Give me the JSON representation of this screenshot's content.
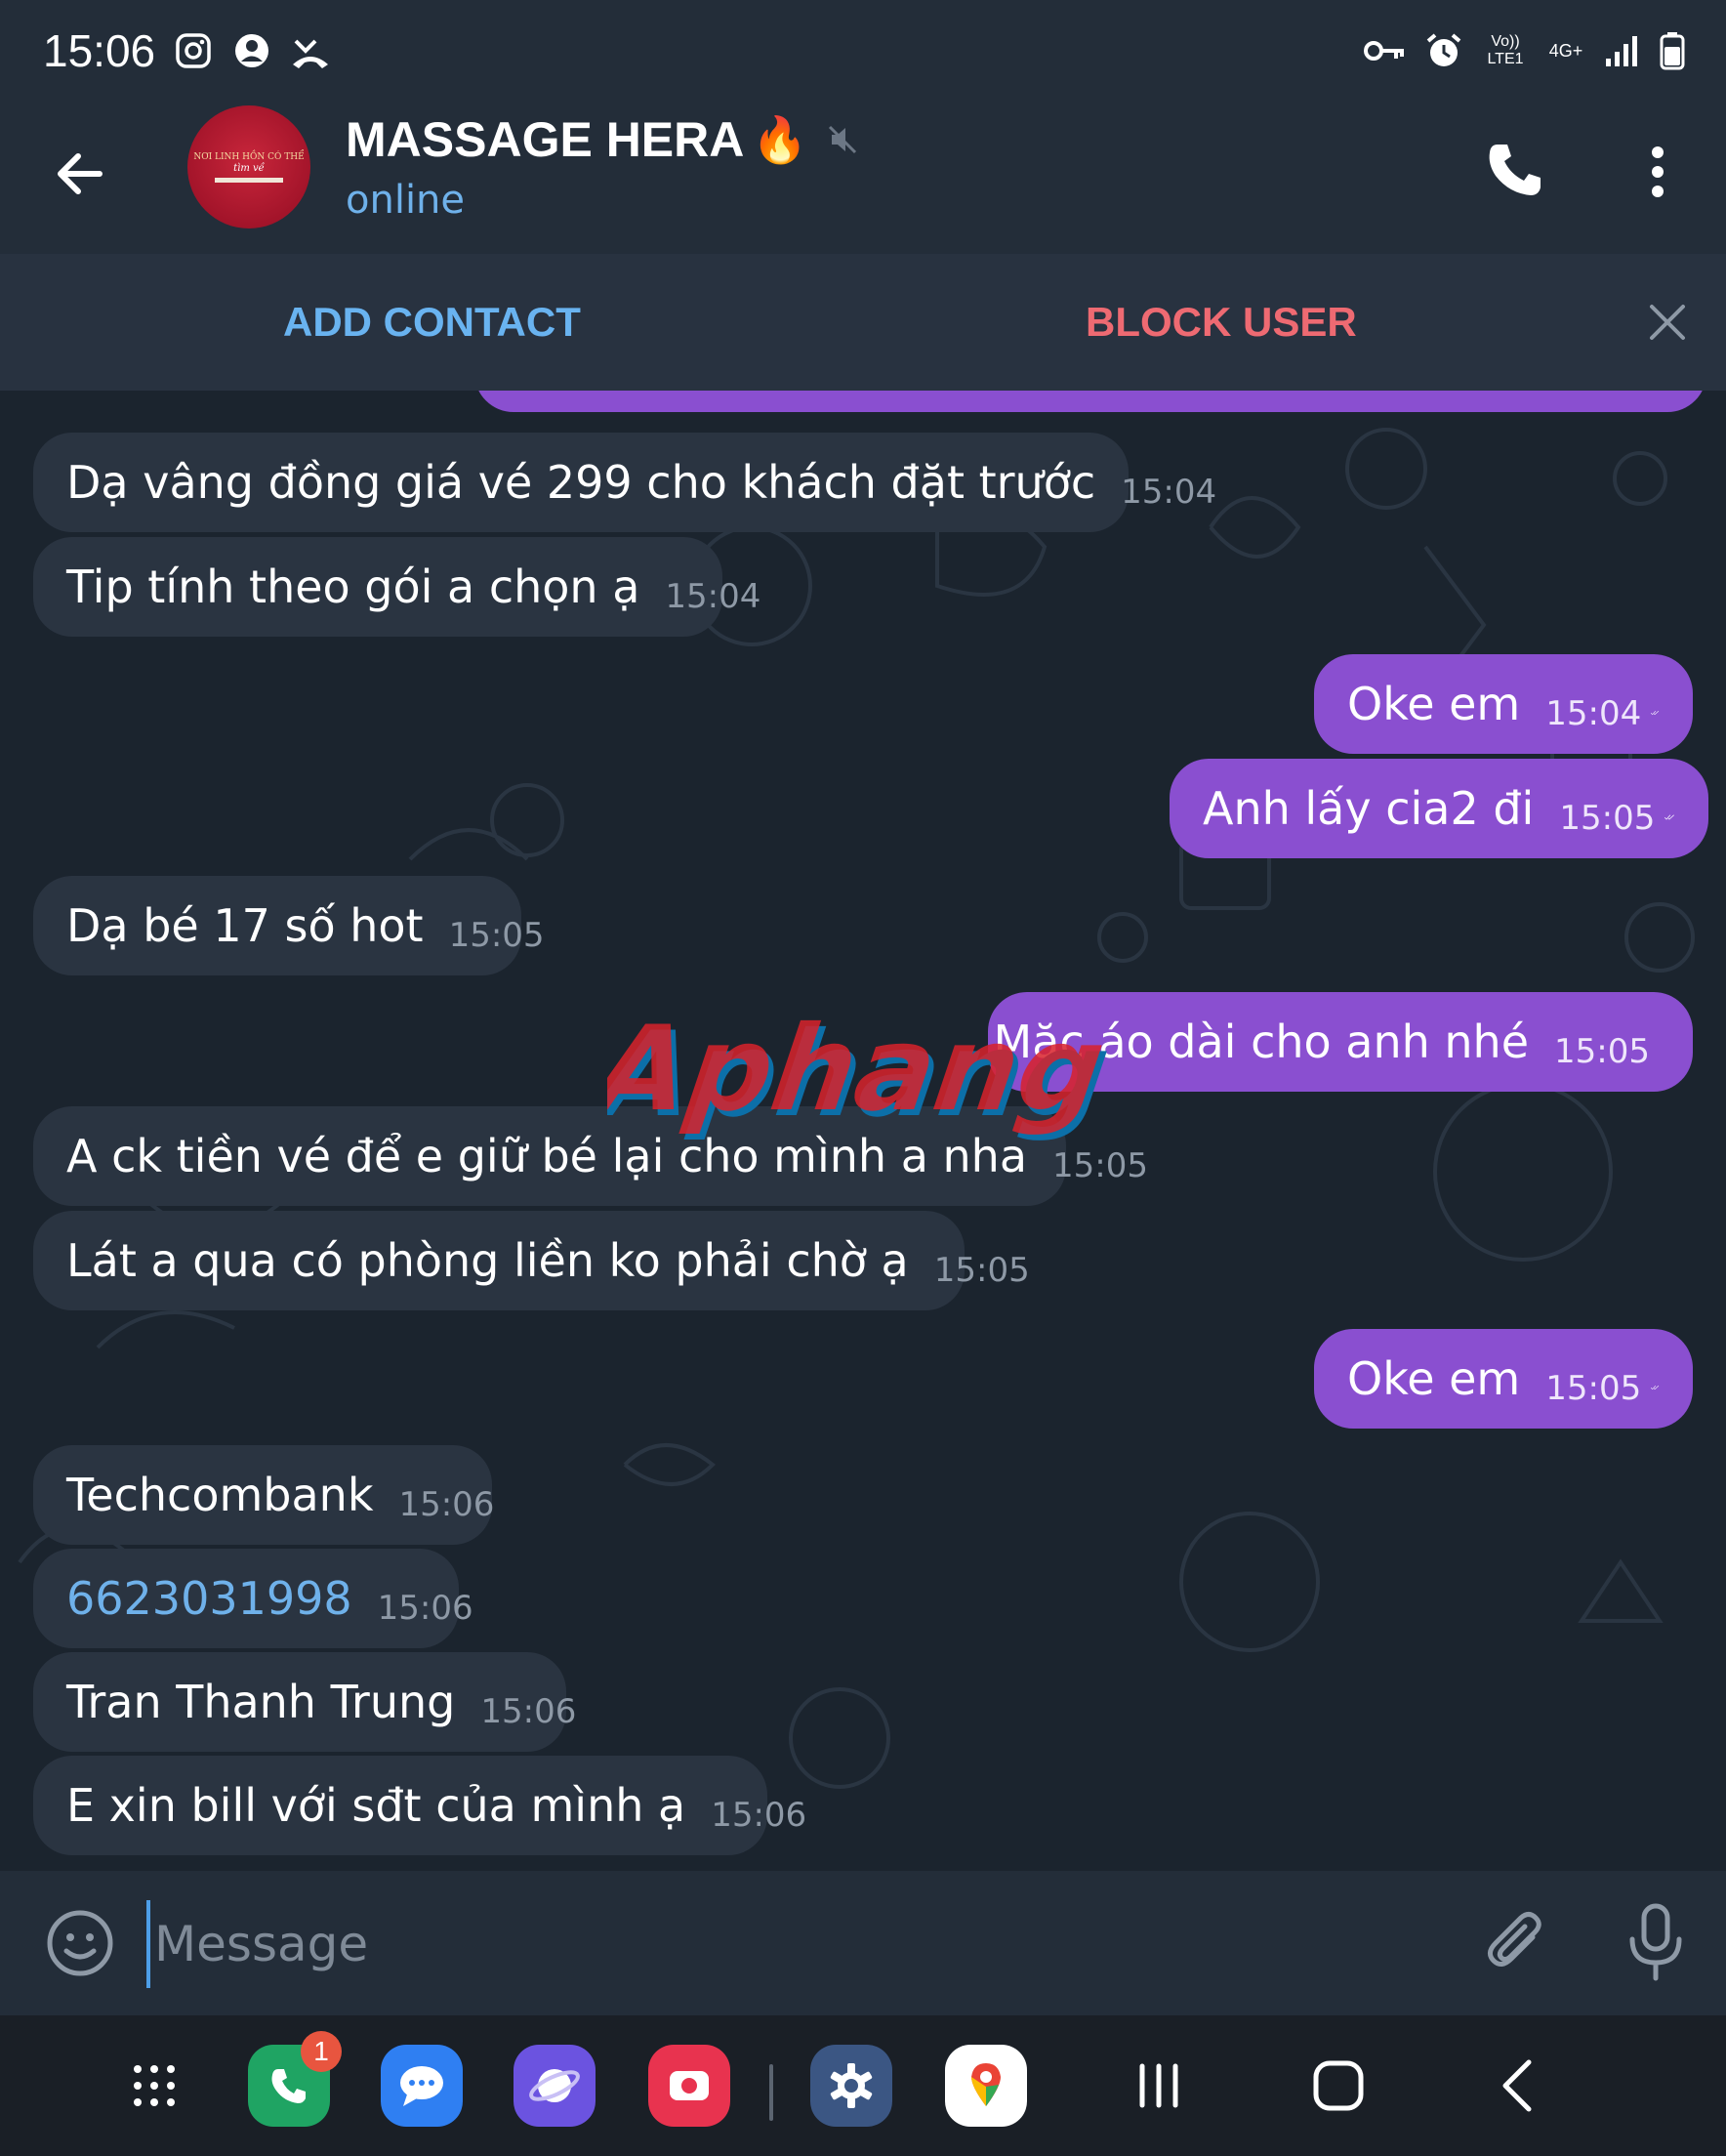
{
  "status_bar": {
    "time": "15:06",
    "left_icons": [
      "instagram-icon",
      "account-icon",
      "missed-call-icon"
    ],
    "right_icons": [
      "vpn-key-icon",
      "alarm-icon",
      "volte-icon",
      "4g-icon",
      "signal-icon",
      "battery-icon"
    ],
    "volte_label": "Vo)) LTE1",
    "network_label": "4G+"
  },
  "header": {
    "contact_name": "MASSAGE HERA",
    "name_emoji": "🔥",
    "status": "online",
    "avatar_line1": "NƠI LINH HỒN CÓ THỂ",
    "avatar_line2": "tìm về"
  },
  "action_bar": {
    "add_contact": "ADD CONTACT",
    "block_user": "BLOCK USER"
  },
  "messages": [
    {
      "dir": "in",
      "text": "Dạ vâng đồng giá vé 299 cho khách đặt trước",
      "time": "15:04"
    },
    {
      "dir": "in",
      "text": "Tip tính theo gói a chọn ạ",
      "time": "15:04"
    },
    {
      "dir": "out",
      "text": "Oke em",
      "time": "15:04"
    },
    {
      "dir": "out",
      "text": "Anh lấy cia2 đi",
      "time": "15:05"
    },
    {
      "dir": "in",
      "text": "Dạ bé 17 số hot",
      "time": "15:05"
    },
    {
      "dir": "out",
      "text": "Mặc áo dài cho anh nhé",
      "time": "15:05"
    },
    {
      "dir": "in",
      "text": "A ck tiền vé để e giữ bé lại cho mình a nha",
      "time": "15:05"
    },
    {
      "dir": "in",
      "text": "Lát a qua có phòng liền ko phải chờ ạ",
      "time": "15:05"
    },
    {
      "dir": "out",
      "text": "Oke em",
      "time": "15:05"
    },
    {
      "dir": "in",
      "text": "Techcombank",
      "time": "15:06"
    },
    {
      "dir": "in",
      "text": "6623031998",
      "time": "15:06",
      "link": true
    },
    {
      "dir": "in",
      "text": "Tran Thanh Trung",
      "time": "15:06"
    },
    {
      "dir": "in",
      "text": "E xin bill với sđt của mình ạ",
      "time": "15:06"
    }
  ],
  "watermark": "Aphang",
  "composer": {
    "placeholder": "Message"
  },
  "navbar": {
    "apps": [
      "apps-grid-icon",
      "phone-app-icon",
      "messages-app-icon",
      "internet-app-icon",
      "screen-recorder-icon",
      "settings-app-icon",
      "maps-app-icon"
    ],
    "phone_badge": "1",
    "colors": {
      "phone": "#1fa463",
      "messages": "#2f7ff2",
      "internet": "#6b53e0",
      "recorder": "#e8334f",
      "settings": "#3b5683"
    }
  },
  "colors": {
    "outgoing_bubble": "#8a4fd0",
    "incoming_bubble": "#2a3441",
    "accent_blue": "#6fb1ea",
    "block_red": "#ee6a72"
  }
}
